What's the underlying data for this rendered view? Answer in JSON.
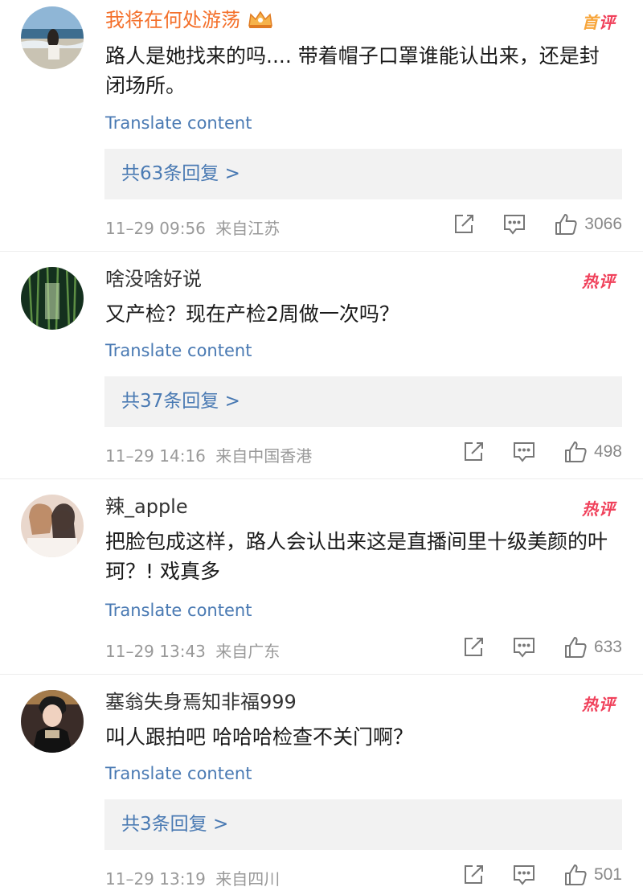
{
  "comments": [
    {
      "username": "我将在何处游荡",
      "crown": "crown-icon",
      "badge": {
        "first": "首",
        "second": "评"
      },
      "text": "路人是她找来的吗.... 带着帽子口罩谁能认出来，还是封闭场所。",
      "translate": "Translate content",
      "replies": "共63条回复 >",
      "time": "11–29 09:56",
      "location": "来自江苏",
      "likes": "3066"
    },
    {
      "username": "啥没啥好说",
      "badge": {
        "first": "热",
        "second": "评"
      },
      "text": "又产检？现在产检2周做一次吗？",
      "translate": "Translate content",
      "replies": "共37条回复 >",
      "time": "11–29 14:16",
      "location": "来自中国香港",
      "likes": "498"
    },
    {
      "username": "辣_apple",
      "badge": {
        "first": "热",
        "second": "评"
      },
      "text": "把脸包成这样，路人会认出来这是直播间里十级美颜的叶珂？! 戏真多",
      "translate": "Translate content",
      "time": "11–29 13:43",
      "location": "来自广东",
      "likes": "633"
    },
    {
      "username": "塞翁失身焉知非福999",
      "badge": {
        "first": "热",
        "second": "评"
      },
      "text": "叫人跟拍吧 哈哈哈检查不关门啊？",
      "translate": "Translate content",
      "replies": "共3条回复 >",
      "time": "11–29 13:19",
      "location": "来自四川",
      "likes": "501"
    }
  ],
  "icons": {
    "share": "share-icon",
    "comment": "comment-icon",
    "like": "thumbs-up-icon"
  },
  "colors": {
    "vip_name": "#f4702b",
    "link": "#4a7ab3",
    "meta": "#999999",
    "badge_orange": "#f7a53a",
    "badge_red": "#f0415b",
    "reply_bg": "#f2f2f2"
  }
}
